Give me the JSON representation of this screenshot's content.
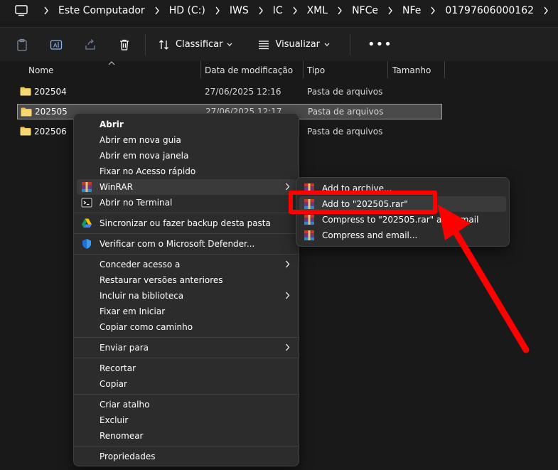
{
  "address_bar": {
    "breadcrumbs": [
      "Este Computador",
      "HD (C:)",
      "IWS",
      "IC",
      "XML",
      "NFCe",
      "NFe",
      "01797606000162"
    ]
  },
  "toolbar": {
    "sort_label": "Classificar",
    "view_label": "Visualizar",
    "more_label": "•••"
  },
  "columns": {
    "name": "Nome",
    "date": "Data de modificação",
    "type": "Tipo",
    "size": "Tamanho"
  },
  "files": [
    {
      "name": "202504",
      "date": "27/06/2025 12:16",
      "type": "Pasta de arquivos"
    },
    {
      "name": "202505",
      "date": "27/06/2025 12:17",
      "type": "Pasta de arquivos"
    },
    {
      "name": "202506",
      "date": "",
      "type": "Pasta de arquivos"
    }
  ],
  "context_menu": {
    "open": "Abrir",
    "open_new_tab": "Abrir em nova guia",
    "open_new_window": "Abrir em nova janela",
    "pin_quick_access": "Fixar no Acesso rápido",
    "winrar": "WinRAR",
    "open_terminal": "Abrir no Terminal",
    "sync_backup": "Sincronizar ou fazer backup desta pasta",
    "defender_scan": "Verificar com o Microsoft Defender...",
    "grant_access": "Conceder acesso a",
    "restore_versions": "Restaurar versões anteriores",
    "include_library": "Incluir na biblioteca",
    "pin_start": "Fixar em Iniciar",
    "copy_path": "Copiar como caminho",
    "send_to": "Enviar para",
    "cut": "Recortar",
    "copy": "Copiar",
    "create_shortcut": "Criar atalho",
    "delete": "Excluir",
    "rename": "Renomear",
    "properties": "Propriedades"
  },
  "winrar_submenu": {
    "add_archive": "Add to archive...",
    "add_to_rar": "Add to \"202505.rar\"",
    "compress_email": "Compress to \"202505.rar\" and email",
    "compress_and_email": "Compress and email..."
  },
  "colors": {
    "annotation": "#ff0000",
    "background": "#191919",
    "menu": "#2c2c2c"
  }
}
